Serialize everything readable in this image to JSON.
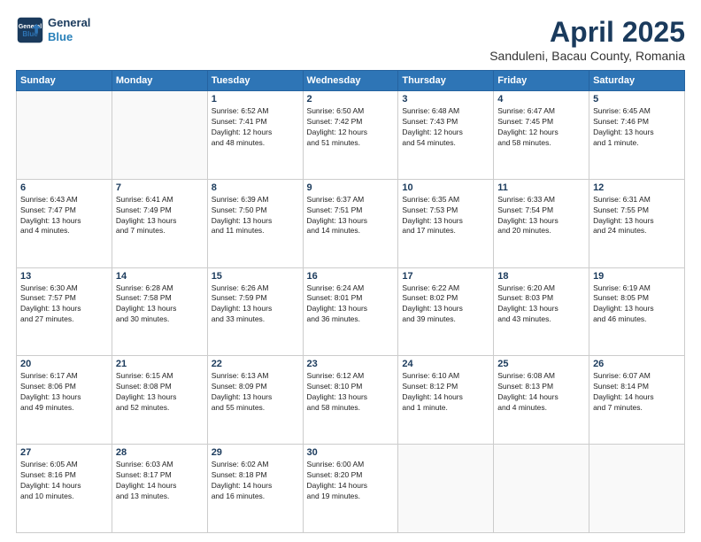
{
  "header": {
    "logo_line1": "General",
    "logo_line2": "Blue",
    "month_title": "April 2025",
    "subtitle": "Sanduleni, Bacau County, Romania"
  },
  "weekdays": [
    "Sunday",
    "Monday",
    "Tuesday",
    "Wednesday",
    "Thursday",
    "Friday",
    "Saturday"
  ],
  "weeks": [
    [
      {
        "day": "",
        "info": ""
      },
      {
        "day": "",
        "info": ""
      },
      {
        "day": "1",
        "info": "Sunrise: 6:52 AM\nSunset: 7:41 PM\nDaylight: 12 hours\nand 48 minutes."
      },
      {
        "day": "2",
        "info": "Sunrise: 6:50 AM\nSunset: 7:42 PM\nDaylight: 12 hours\nand 51 minutes."
      },
      {
        "day": "3",
        "info": "Sunrise: 6:48 AM\nSunset: 7:43 PM\nDaylight: 12 hours\nand 54 minutes."
      },
      {
        "day": "4",
        "info": "Sunrise: 6:47 AM\nSunset: 7:45 PM\nDaylight: 12 hours\nand 58 minutes."
      },
      {
        "day": "5",
        "info": "Sunrise: 6:45 AM\nSunset: 7:46 PM\nDaylight: 13 hours\nand 1 minute."
      }
    ],
    [
      {
        "day": "6",
        "info": "Sunrise: 6:43 AM\nSunset: 7:47 PM\nDaylight: 13 hours\nand 4 minutes."
      },
      {
        "day": "7",
        "info": "Sunrise: 6:41 AM\nSunset: 7:49 PM\nDaylight: 13 hours\nand 7 minutes."
      },
      {
        "day": "8",
        "info": "Sunrise: 6:39 AM\nSunset: 7:50 PM\nDaylight: 13 hours\nand 11 minutes."
      },
      {
        "day": "9",
        "info": "Sunrise: 6:37 AM\nSunset: 7:51 PM\nDaylight: 13 hours\nand 14 minutes."
      },
      {
        "day": "10",
        "info": "Sunrise: 6:35 AM\nSunset: 7:53 PM\nDaylight: 13 hours\nand 17 minutes."
      },
      {
        "day": "11",
        "info": "Sunrise: 6:33 AM\nSunset: 7:54 PM\nDaylight: 13 hours\nand 20 minutes."
      },
      {
        "day": "12",
        "info": "Sunrise: 6:31 AM\nSunset: 7:55 PM\nDaylight: 13 hours\nand 24 minutes."
      }
    ],
    [
      {
        "day": "13",
        "info": "Sunrise: 6:30 AM\nSunset: 7:57 PM\nDaylight: 13 hours\nand 27 minutes."
      },
      {
        "day": "14",
        "info": "Sunrise: 6:28 AM\nSunset: 7:58 PM\nDaylight: 13 hours\nand 30 minutes."
      },
      {
        "day": "15",
        "info": "Sunrise: 6:26 AM\nSunset: 7:59 PM\nDaylight: 13 hours\nand 33 minutes."
      },
      {
        "day": "16",
        "info": "Sunrise: 6:24 AM\nSunset: 8:01 PM\nDaylight: 13 hours\nand 36 minutes."
      },
      {
        "day": "17",
        "info": "Sunrise: 6:22 AM\nSunset: 8:02 PM\nDaylight: 13 hours\nand 39 minutes."
      },
      {
        "day": "18",
        "info": "Sunrise: 6:20 AM\nSunset: 8:03 PM\nDaylight: 13 hours\nand 43 minutes."
      },
      {
        "day": "19",
        "info": "Sunrise: 6:19 AM\nSunset: 8:05 PM\nDaylight: 13 hours\nand 46 minutes."
      }
    ],
    [
      {
        "day": "20",
        "info": "Sunrise: 6:17 AM\nSunset: 8:06 PM\nDaylight: 13 hours\nand 49 minutes."
      },
      {
        "day": "21",
        "info": "Sunrise: 6:15 AM\nSunset: 8:08 PM\nDaylight: 13 hours\nand 52 minutes."
      },
      {
        "day": "22",
        "info": "Sunrise: 6:13 AM\nSunset: 8:09 PM\nDaylight: 13 hours\nand 55 minutes."
      },
      {
        "day": "23",
        "info": "Sunrise: 6:12 AM\nSunset: 8:10 PM\nDaylight: 13 hours\nand 58 minutes."
      },
      {
        "day": "24",
        "info": "Sunrise: 6:10 AM\nSunset: 8:12 PM\nDaylight: 14 hours\nand 1 minute."
      },
      {
        "day": "25",
        "info": "Sunrise: 6:08 AM\nSunset: 8:13 PM\nDaylight: 14 hours\nand 4 minutes."
      },
      {
        "day": "26",
        "info": "Sunrise: 6:07 AM\nSunset: 8:14 PM\nDaylight: 14 hours\nand 7 minutes."
      }
    ],
    [
      {
        "day": "27",
        "info": "Sunrise: 6:05 AM\nSunset: 8:16 PM\nDaylight: 14 hours\nand 10 minutes."
      },
      {
        "day": "28",
        "info": "Sunrise: 6:03 AM\nSunset: 8:17 PM\nDaylight: 14 hours\nand 13 minutes."
      },
      {
        "day": "29",
        "info": "Sunrise: 6:02 AM\nSunset: 8:18 PM\nDaylight: 14 hours\nand 16 minutes."
      },
      {
        "day": "30",
        "info": "Sunrise: 6:00 AM\nSunset: 8:20 PM\nDaylight: 14 hours\nand 19 minutes."
      },
      {
        "day": "",
        "info": ""
      },
      {
        "day": "",
        "info": ""
      },
      {
        "day": "",
        "info": ""
      }
    ]
  ]
}
